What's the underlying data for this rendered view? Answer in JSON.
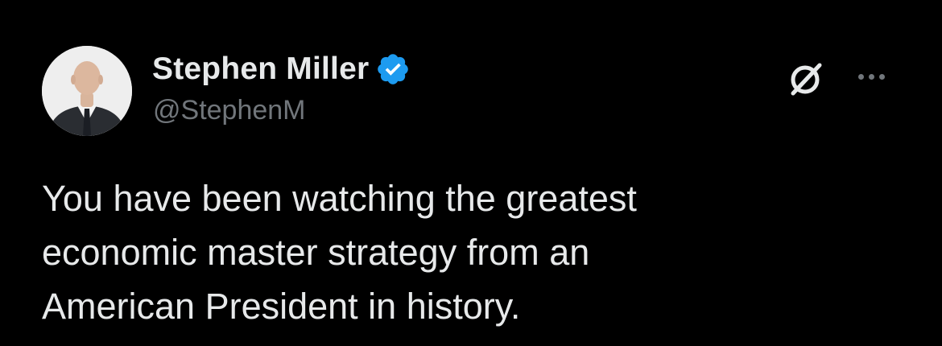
{
  "author": {
    "display_name": "Stephen Miller",
    "handle": "@StephenM",
    "verified": true,
    "verified_color": "#1d9bf0"
  },
  "tweet": {
    "text": "You have been watching the greatest\neconomic master strategy from an\nAmerican President in history."
  },
  "actions": {
    "grok_icon": "grok-icon",
    "more_icon": "more-horizontal-icon"
  },
  "theme": {
    "background": "#000000",
    "primary_text": "#e7e9ea",
    "secondary_text": "#71767b"
  }
}
